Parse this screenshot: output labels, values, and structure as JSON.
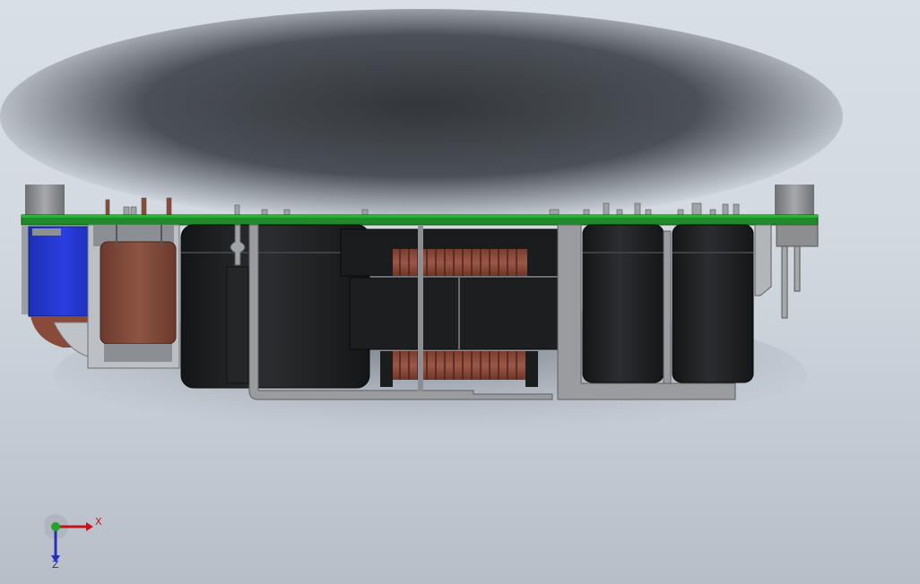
{
  "viewport": {
    "background_top": "#d9dfe6",
    "background_bottom": "#b7bec8"
  },
  "model": {
    "pcb_color": "#1f8a2a",
    "capacitor_color": "#1e1f21",
    "winding_color": "#8a4a3a",
    "connector_color": "#1a2ad0",
    "bracket_color": "#8d8f92",
    "standoff_color": "#8c8e90"
  },
  "triad": {
    "x_label": "X",
    "z_label": "Z",
    "x_color": "#c0161b",
    "y_color": "#22a52a",
    "z_color": "#2530b8"
  }
}
